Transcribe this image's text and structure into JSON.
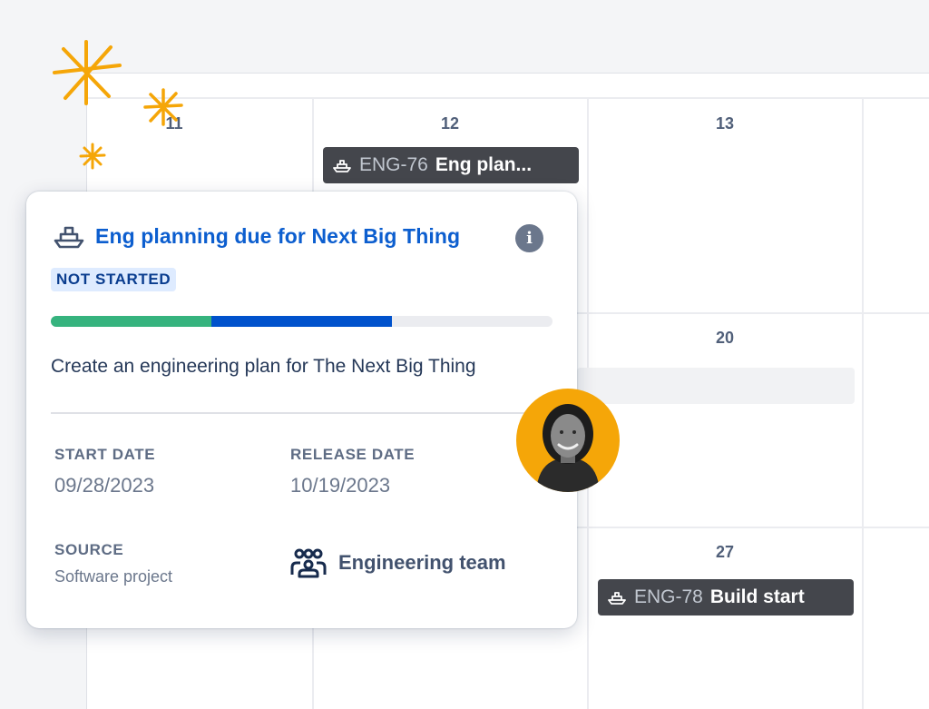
{
  "calendar": {
    "days": [
      "11",
      "12",
      "13",
      "20",
      "27"
    ],
    "events": [
      {
        "key": "ENG-76",
        "title": "Eng plan..."
      },
      {
        "key": "ENG-78",
        "title": "Build start"
      }
    ]
  },
  "card": {
    "title": "Eng planning due for Next Big Thing",
    "status": "NOT STARTED",
    "progress": {
      "done": 0.32,
      "in_progress": 0.36
    },
    "description": "Create an engineering plan for The Next Big Thing",
    "start_label": "START DATE",
    "start_value": "09/28/2023",
    "release_label": "RELEASE DATE",
    "release_value": "10/19/2023",
    "source_label": "SOURCE",
    "source_value": "Software project",
    "team": "Engineering team"
  },
  "colors": {
    "title_blue": "#0c5ecf",
    "progress_green": "#36b37e",
    "progress_blue": "#0052cc",
    "avatar_bg": "#f5a608",
    "sparkle": "#f5a608"
  },
  "icons": [
    "ship-icon",
    "info-icon",
    "team-icon",
    "sparkle-icon"
  ]
}
